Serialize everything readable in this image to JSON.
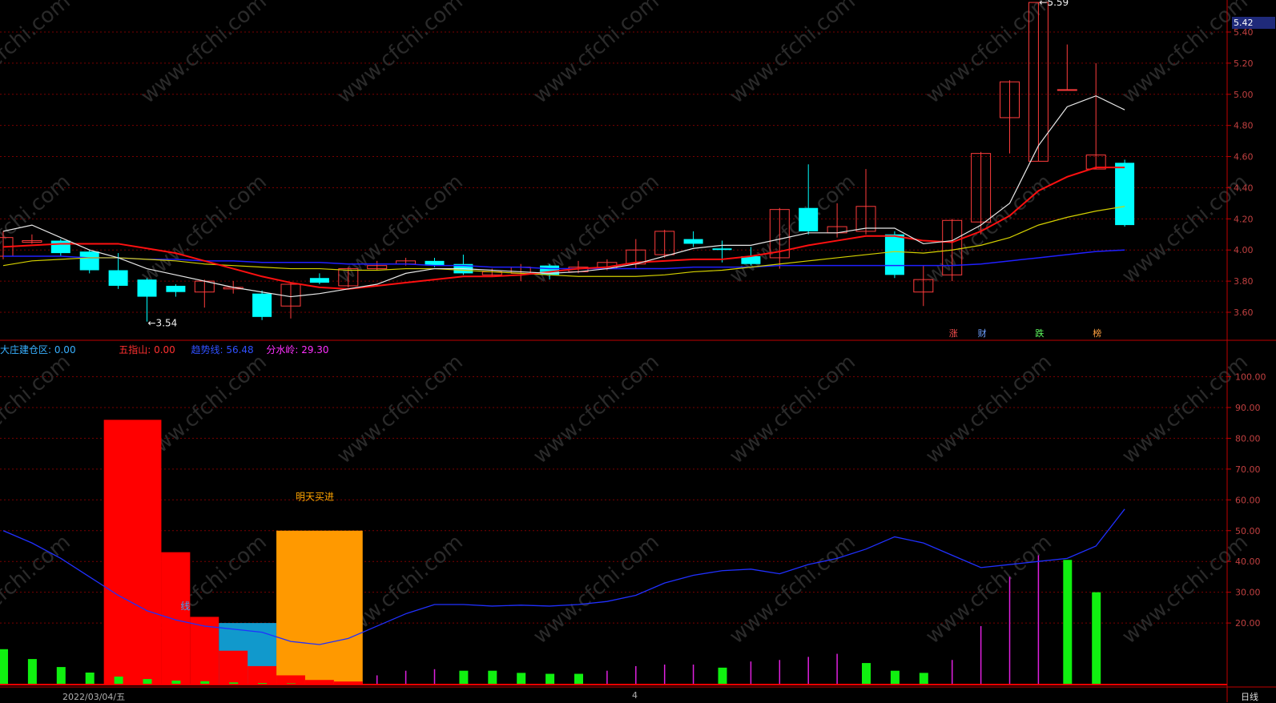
{
  "chart_data": [
    {
      "type": "candlestick",
      "title": "",
      "ylim": [
        3.5,
        5.6
      ],
      "y_ticks": [
        "5.40",
        "5.20",
        "5.00",
        "4.80",
        "4.60",
        "4.40",
        "4.20",
        "4.00",
        "3.80",
        "3.60"
      ],
      "last_price": "5.42",
      "candles": [
        {
          "o": 3.96,
          "c": 4.08,
          "h": 4.12,
          "l": 3.94
        },
        {
          "o": 4.05,
          "c": 4.06,
          "h": 4.1,
          "l": 4.04
        },
        {
          "o": 4.06,
          "c": 3.98,
          "h": 4.07,
          "l": 3.96
        },
        {
          "o": 3.99,
          "c": 3.87,
          "h": 4.0,
          "l": 3.85
        },
        {
          "o": 3.87,
          "c": 3.77,
          "h": 3.98,
          "l": 3.75
        },
        {
          "o": 3.81,
          "c": 3.7,
          "h": 3.82,
          "l": 3.54
        },
        {
          "o": 3.77,
          "c": 3.73,
          "h": 3.78,
          "l": 3.7
        },
        {
          "o": 3.73,
          "c": 3.8,
          "h": 3.81,
          "l": 3.63
        },
        {
          "o": 3.75,
          "c": 3.76,
          "h": 3.8,
          "l": 3.72
        },
        {
          "o": 3.72,
          "c": 3.57,
          "h": 3.74,
          "l": 3.55
        },
        {
          "o": 3.64,
          "c": 3.78,
          "h": 3.79,
          "l": 3.56
        },
        {
          "o": 3.82,
          "c": 3.79,
          "h": 3.85,
          "l": 3.78
        },
        {
          "o": 3.77,
          "c": 3.88,
          "h": 3.89,
          "l": 3.76
        },
        {
          "o": 3.88,
          "c": 3.9,
          "h": 3.93,
          "l": 3.87
        },
        {
          "o": 3.91,
          "c": 3.93,
          "h": 3.95,
          "l": 3.9
        },
        {
          "o": 3.93,
          "c": 3.9,
          "h": 3.95,
          "l": 3.89
        },
        {
          "o": 3.91,
          "c": 3.85,
          "h": 3.97,
          "l": 3.84
        },
        {
          "o": 3.84,
          "c": 3.86,
          "h": 3.88,
          "l": 3.83
        },
        {
          "o": 3.85,
          "c": 3.89,
          "h": 3.91,
          "l": 3.8
        },
        {
          "o": 3.9,
          "c": 3.84,
          "h": 3.91,
          "l": 3.81
        },
        {
          "o": 3.86,
          "c": 3.89,
          "h": 3.93,
          "l": 3.85
        },
        {
          "o": 3.88,
          "c": 3.92,
          "h": 3.94,
          "l": 3.87
        },
        {
          "o": 3.91,
          "c": 4.0,
          "h": 4.07,
          "l": 3.88
        },
        {
          "o": 3.97,
          "c": 4.12,
          "h": 4.13,
          "l": 3.95
        },
        {
          "o": 4.07,
          "c": 4.04,
          "h": 4.12,
          "l": 4.02
        },
        {
          "o": 4.01,
          "c": 4.0,
          "h": 4.06,
          "l": 3.92
        },
        {
          "o": 3.96,
          "c": 3.91,
          "h": 4.02,
          "l": 3.9
        },
        {
          "o": 3.95,
          "c": 4.26,
          "h": 4.27,
          "l": 3.88
        },
        {
          "o": 4.27,
          "c": 4.12,
          "h": 4.55,
          "l": 4.1
        },
        {
          "o": 4.11,
          "c": 4.15,
          "h": 4.3,
          "l": 4.08
        },
        {
          "o": 4.12,
          "c": 4.28,
          "h": 4.52,
          "l": 4.1
        },
        {
          "o": 4.1,
          "c": 3.84,
          "h": 4.12,
          "l": 3.82
        },
        {
          "o": 3.73,
          "c": 3.81,
          "h": 3.9,
          "l": 3.64
        },
        {
          "o": 3.84,
          "c": 4.19,
          "h": 4.2,
          "l": 3.8
        },
        {
          "o": 4.18,
          "c": 4.62,
          "h": 4.63,
          "l": 4.1
        },
        {
          "o": 4.85,
          "c": 5.08,
          "h": 5.09,
          "l": 4.62
        },
        {
          "o": 4.57,
          "c": 5.59,
          "h": 5.59,
          "l": 4.57
        },
        {
          "o": 5.03,
          "c": 5.03,
          "h": 5.32,
          "l": 5.03
        },
        {
          "o": 4.52,
          "c": 4.61,
          "h": 5.2,
          "l": 4.52
        },
        {
          "o": 4.56,
          "c": 4.16,
          "h": 4.58,
          "l": 4.15
        }
      ],
      "ma_white": [
        4.12,
        4.16,
        4.08,
        4.0,
        3.95,
        3.88,
        3.84,
        3.8,
        3.76,
        3.73,
        3.7,
        3.72,
        3.75,
        3.78,
        3.85,
        3.88,
        3.88,
        3.87,
        3.86,
        3.85,
        3.86,
        3.88,
        3.91,
        3.96,
        4.01,
        4.03,
        4.03,
        4.07,
        4.11,
        4.11,
        4.14,
        4.14,
        4.04,
        4.06,
        4.16,
        4.3,
        4.67,
        4.92,
        4.99,
        4.9
      ],
      "ma_red": [
        4.02,
        4.03,
        4.04,
        4.04,
        4.04,
        4.01,
        3.98,
        3.93,
        3.88,
        3.83,
        3.79,
        3.76,
        3.75,
        3.77,
        3.79,
        3.81,
        3.83,
        3.83,
        3.84,
        3.86,
        3.88,
        3.89,
        3.92,
        3.93,
        3.94,
        3.94,
        3.96,
        3.99,
        4.03,
        4.06,
        4.09,
        4.09,
        4.06,
        4.05,
        4.12,
        4.22,
        4.38,
        4.47,
        4.53,
        4.53
      ],
      "ma_yellow": [
        3.9,
        3.93,
        3.94,
        3.95,
        3.95,
        3.94,
        3.93,
        3.91,
        3.9,
        3.89,
        3.88,
        3.88,
        3.87,
        3.87,
        3.88,
        3.88,
        3.87,
        3.86,
        3.85,
        3.84,
        3.83,
        3.83,
        3.83,
        3.84,
        3.86,
        3.87,
        3.89,
        3.91,
        3.93,
        3.95,
        3.97,
        3.99,
        3.98,
        4.0,
        4.03,
        4.08,
        4.16,
        4.21,
        4.25,
        4.28
      ],
      "ma_blue": [
        3.96,
        3.96,
        3.96,
        3.95,
        3.95,
        3.94,
        3.94,
        3.93,
        3.93,
        3.92,
        3.92,
        3.92,
        3.91,
        3.91,
        3.91,
        3.9,
        3.9,
        3.89,
        3.89,
        3.88,
        3.88,
        3.88,
        3.88,
        3.88,
        3.89,
        3.89,
        3.89,
        3.9,
        3.9,
        3.9,
        3.9,
        3.9,
        3.9,
        3.9,
        3.91,
        3.93,
        3.95,
        3.97,
        3.99,
        4.0
      ],
      "annotations": [
        {
          "text": "←3.54",
          "candle": 5,
          "value": 3.53
        },
        {
          "text": "←5.59",
          "candle": 36,
          "value": 5.59
        }
      ],
      "markers": [
        {
          "text": "涨",
          "candle": 33,
          "color": "#ff5050"
        },
        {
          "text": "财",
          "candle": 34,
          "color": "#6ea0ff"
        },
        {
          "text": "跌",
          "candle": 36,
          "color": "#60ff60"
        },
        {
          "text": "榜",
          "candle": 38,
          "color": "#ffa040"
        }
      ]
    },
    {
      "type": "indicator",
      "ylim": [
        0,
        110
      ],
      "y_ticks": [
        "100.00",
        "90.00",
        "80.00",
        "70.00",
        "60.00",
        "50.00",
        "40.00",
        "30.00",
        "20.00"
      ],
      "blocks": [
        {
          "from": 3.5,
          "to": 5.5,
          "value": 86,
          "color": "#ff0000"
        },
        {
          "from": 5.5,
          "to": 6.5,
          "value": 43,
          "color": "#ff0000"
        },
        {
          "from": 6.5,
          "to": 7.5,
          "value": 22,
          "color": "#ff0000"
        },
        {
          "from": 7.5,
          "to": 9.5,
          "value": 20,
          "color": "#1199cc"
        },
        {
          "from": 9.5,
          "to": 12.5,
          "value": 50,
          "color": "#ff9900"
        },
        {
          "from": 7.5,
          "to": 8.5,
          "value": 11,
          "color": "#ff0000"
        },
        {
          "from": 8.5,
          "to": 9.5,
          "value": 6,
          "color": "#ff0000"
        },
        {
          "from": 9.5,
          "to": 10.5,
          "value": 3,
          "color": "#ff0000"
        },
        {
          "from": 10.5,
          "to": 11.5,
          "value": 1.5,
          "color": "#ff0000"
        },
        {
          "from": 11.5,
          "to": 12.5,
          "value": 1,
          "color": "#ff0000"
        }
      ],
      "green_bars": [
        {
          "i": 0,
          "v": 11.5
        },
        {
          "i": 1,
          "v": 8.3
        },
        {
          "i": 2,
          "v": 5.7
        },
        {
          "i": 3,
          "v": 3.9
        },
        {
          "i": 4,
          "v": 2.6
        },
        {
          "i": 5,
          "v": 1.8
        },
        {
          "i": 6,
          "v": 1.3
        },
        {
          "i": 7,
          "v": 1.1
        },
        {
          "i": 8,
          "v": 0.7
        },
        {
          "i": 9,
          "v": 0.5
        },
        {
          "i": 10,
          "v": 0.4
        },
        {
          "i": 16,
          "v": 4.5
        },
        {
          "i": 17,
          "v": 4.5
        },
        {
          "i": 18,
          "v": 3.8
        },
        {
          "i": 19,
          "v": 3.5
        },
        {
          "i": 20,
          "v": 3.5
        },
        {
          "i": 25,
          "v": 5.5
        },
        {
          "i": 30,
          "v": 7
        },
        {
          "i": 31,
          "v": 4.5
        },
        {
          "i": 32,
          "v": 3.8
        },
        {
          "i": 37,
          "v": 40.5
        },
        {
          "i": 38,
          "v": 30
        }
      ],
      "magenta_lines": [
        {
          "i": 13,
          "v": 3
        },
        {
          "i": 14,
          "v": 4.5
        },
        {
          "i": 15,
          "v": 5
        },
        {
          "i": 21,
          "v": 4.5
        },
        {
          "i": 22,
          "v": 6
        },
        {
          "i": 23,
          "v": 6.5
        },
        {
          "i": 24,
          "v": 6.5
        },
        {
          "i": 26,
          "v": 7.5
        },
        {
          "i": 27,
          "v": 8
        },
        {
          "i": 28,
          "v": 9
        },
        {
          "i": 29,
          "v": 10
        },
        {
          "i": 33,
          "v": 8
        },
        {
          "i": 34,
          "v": 19
        },
        {
          "i": 35,
          "v": 35
        },
        {
          "i": 36,
          "v": 42
        }
      ],
      "blue_line": [
        50,
        46,
        41,
        35,
        29,
        24,
        21,
        19,
        18,
        17,
        14,
        13,
        15,
        19,
        23,
        26,
        26,
        25.5,
        25.8,
        25.5,
        26,
        27,
        29,
        33,
        35.5,
        37,
        37.5,
        36,
        39,
        41,
        44,
        48,
        46,
        42,
        38,
        39,
        40,
        41,
        45,
        57
      ],
      "labels": [
        {
          "text": "明天买进",
          "candle": 10,
          "value": 60,
          "color": "#ffa500"
        },
        {
          "text": "线",
          "candle": 6,
          "value": 24.5,
          "color": "#33aaff"
        }
      ]
    }
  ],
  "indicator_info": [
    {
      "text": "大庄建仓区: 0.00",
      "color": "#38b0ff"
    },
    {
      "text": "五指山: 0.00",
      "color": "#ff3030"
    },
    {
      "text": "趋势线: 56.48",
      "color": "#3050ff"
    },
    {
      "text": "分水岭: 29.30",
      "color": "#ff30ff"
    }
  ],
  "watermark": "www.cfchi.com",
  "bottom_date": "2022/03/04/五",
  "bottom_tick": "4",
  "period_label": "日线",
  "price_badge": "5.42",
  "colors": {
    "up": "#ff3c3c",
    "down": "#00ffff",
    "grid": "#7a0000",
    "axis": "#c00000",
    "tick_text": "#c04040"
  }
}
